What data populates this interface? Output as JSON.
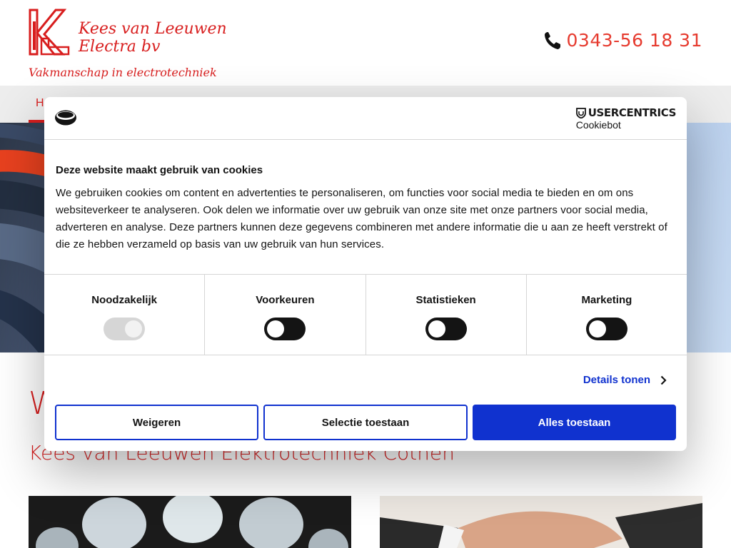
{
  "header": {
    "logo_name_line1": "Kees van Leeuwen",
    "logo_name_line2": "Electra bv",
    "tagline": "Vakmanschap in electrotechniek",
    "phone": "0343-56 18 31"
  },
  "nav": {
    "items": [
      {
        "label": "H"
      }
    ]
  },
  "content": {
    "heading": "W",
    "subheading": "Kees van Leeuwen Elektrotechniek Cothen"
  },
  "cookie_dialog": {
    "brand": "USERCENTRICS",
    "brand_sub": "Cookiebot",
    "title": "Deze website maakt gebruik van cookies",
    "text": "We gebruiken cookies om content en advertenties te personaliseren, om functies voor social media te bieden en om ons websiteverkeer te analyseren. Ook delen we informatie over uw gebruik van onze site met onze partners voor social media, adverteren en analyse. Deze partners kunnen deze gegevens combineren met andere informatie die u aan ze heeft verstrekt of die ze hebben verzameld op basis van uw gebruik van hun services.",
    "categories": [
      {
        "label": "Noodzakelijk",
        "enabled": true,
        "locked": true
      },
      {
        "label": "Voorkeuren",
        "enabled": false,
        "locked": false
      },
      {
        "label": "Statistieken",
        "enabled": false,
        "locked": false
      },
      {
        "label": "Marketing",
        "enabled": false,
        "locked": false
      }
    ],
    "details_label": "Details tonen",
    "buttons": {
      "deny": "Weigeren",
      "select": "Selectie toestaan",
      "allow": "Alles toestaan"
    }
  },
  "colors": {
    "brand_red": "#d81e1e",
    "cookiebot_blue": "#1032cf",
    "toggle_dark": "#141414"
  }
}
